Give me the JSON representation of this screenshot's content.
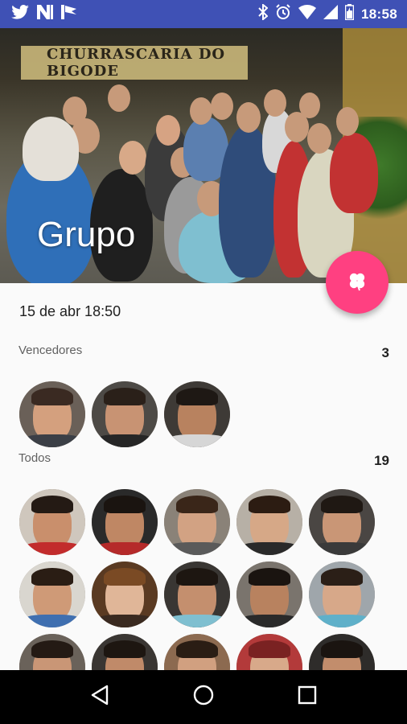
{
  "status_bar": {
    "time": "18:58",
    "left_icons": [
      "twitter-icon",
      "n-app-icon",
      "flag-app-icon"
    ],
    "right_icons": [
      "bluetooth-icon",
      "alarm-icon",
      "wifi-icon",
      "signal-icon",
      "battery-icon"
    ]
  },
  "header": {
    "title": "Grupo",
    "image": "group-photo",
    "sign_text": "CHURRASCARIA DO BIGODE"
  },
  "fab": {
    "icon": "clover-icon",
    "color": "#ff4081"
  },
  "draw": {
    "date": "15 de abr 18:50"
  },
  "winners": {
    "label": "Vencedores",
    "count": "3",
    "avatars": 3
  },
  "all": {
    "label": "Todos",
    "count": "19",
    "avatars_visible": 15
  },
  "colors": {
    "status_bar": "#3f51b5",
    "accent": "#ff4081",
    "nav_bar": "#000000"
  },
  "nav": {
    "back": "back-icon",
    "home": "home-icon",
    "recents": "recents-icon"
  }
}
